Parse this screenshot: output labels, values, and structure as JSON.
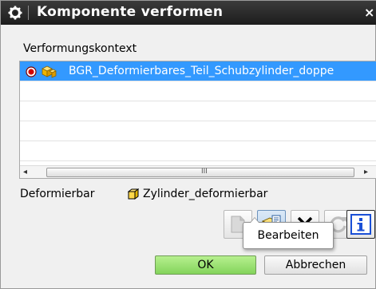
{
  "window": {
    "title": "Komponente verformen",
    "icon": "gear-icon",
    "close_glyph": "×"
  },
  "context": {
    "section_label": "Verformungskontext",
    "rows": [
      {
        "text": "BGR_Deformierbares_Teil_Schubzylinder_doppe",
        "selected": true,
        "icons": [
          "radio-selected-icon",
          "assembly-part-icon"
        ]
      },
      {
        "text": "",
        "selected": false
      },
      {
        "text": "",
        "selected": false
      },
      {
        "text": "",
        "selected": false
      },
      {
        "text": "",
        "selected": false
      }
    ],
    "scrollbar": {
      "left_glyph": "◂",
      "right_glyph": "▸",
      "grip_glyph": "III"
    }
  },
  "deformable": {
    "label": "Deformierbar",
    "icon": "cube-icon",
    "value": "Zylinder_deformierbar"
  },
  "toolbar": {
    "buttons": [
      {
        "name": "new-button",
        "icon": "blank-page-icon",
        "enabled": false
      },
      {
        "name": "edit-button",
        "icon": "edit-part-icon",
        "enabled": true,
        "active": true
      },
      {
        "name": "remove-button",
        "icon": "x-icon",
        "enabled": true
      },
      {
        "name": "refresh-button",
        "icon": "refresh-icon",
        "enabled": false
      },
      {
        "name": "info-button",
        "icon": "info-icon",
        "enabled": true
      }
    ]
  },
  "tooltip": {
    "text": "Bearbeiten"
  },
  "actions": {
    "ok_label": "OK",
    "cancel_label": "Abbrechen"
  },
  "colors": {
    "selection": "#3399ff",
    "title_bar": "#1d1d1d",
    "ok_green": "#83d45b",
    "radio_red": "#d10000",
    "info_blue": "#1a4fd6"
  }
}
